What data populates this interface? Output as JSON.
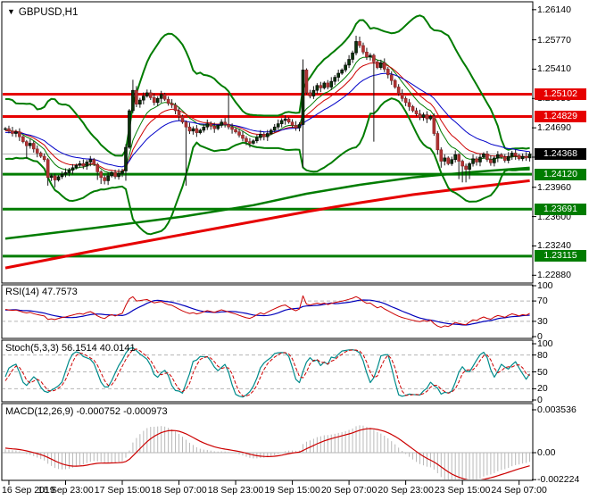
{
  "header": {
    "symbol": "GBPUSD,H1",
    "dropdown_icon": "triangle-down"
  },
  "colors": {
    "bull": "#0a330a",
    "bull_stroke": "#000000",
    "bear": "#b03333",
    "bear_stroke": "#8a2424",
    "wick": "#1a1a1a",
    "band": "#007c00",
    "level_red": "#e60000",
    "level_green": "#007c00",
    "trend_green": "#007c00",
    "trend_red": "#e60000",
    "ema_fast": "#007c00",
    "ema_mid": "#cc0000",
    "ema_slow": "#0000c8",
    "grid_dash": "#b5b5b5",
    "price_line": "#b0b0b0",
    "rsi_main": "#cc0000",
    "rsi_smooth": "#0000bb",
    "stoch_k": "#008b8b",
    "stoch_d": "#cc0000",
    "macd_hist": "#b8b8b8",
    "macd_signal": "#cc0000",
    "border": "#000000"
  },
  "price_axis": {
    "labels": [
      {
        "text": "1.26140",
        "price": 1.2614
      },
      {
        "text": "1.25770",
        "price": 1.2577
      },
      {
        "text": "1.25410",
        "price": 1.2541
      },
      {
        "text": "1.25050",
        "price": 1.2505
      },
      {
        "text": "1.24690",
        "price": 1.2469
      },
      {
        "text": "1.24330",
        "price": 1.2433
      },
      {
        "text": "1.23960",
        "price": 1.2396
      },
      {
        "text": "1.23600",
        "price": 1.236
      },
      {
        "text": "1.23240",
        "price": 1.2324
      },
      {
        "text": "1.22880",
        "price": 1.2288
      }
    ],
    "badges": [
      {
        "text": "1.25102",
        "price": 1.25102,
        "bg": "#e60000"
      },
      {
        "text": "1.24829",
        "price": 1.24829,
        "bg": "#e60000"
      },
      {
        "text": "1.24368",
        "price": 1.24368,
        "bg": "#000000"
      },
      {
        "text": "1.24120",
        "price": 1.2412,
        "bg": "#007c00"
      },
      {
        "text": "1.23691",
        "price": 1.23691,
        "bg": "#007c00"
      },
      {
        "text": "1.23115",
        "price": 1.23115,
        "bg": "#007c00"
      }
    ]
  },
  "time_axis": {
    "labels": [
      {
        "text": "16 Sep 2019",
        "bar": 1,
        "align": "left"
      },
      {
        "text": "16 Sep 23:00",
        "bar": 17,
        "align": "center"
      },
      {
        "text": "17 Sep 15:00",
        "bar": 33,
        "align": "center"
      },
      {
        "text": "18 Sep 07:00",
        "bar": 49,
        "align": "center"
      },
      {
        "text": "18 Sep 23:00",
        "bar": 65,
        "align": "center"
      },
      {
        "text": "19 Sep 15:00",
        "bar": 81,
        "align": "center"
      },
      {
        "text": "20 Sep 07:00",
        "bar": 97,
        "align": "center"
      },
      {
        "text": "20 Sep 23:00",
        "bar": 113,
        "align": "center"
      },
      {
        "text": "23 Sep 15:00",
        "bar": 129,
        "align": "center"
      },
      {
        "text": "24 Sep 07:00",
        "bar": 145,
        "align": "center"
      }
    ]
  },
  "panels": {
    "rsi": {
      "label": "RSI(14) 47.7573",
      "current": 47.7573,
      "period": 14,
      "dashed_levels": [
        70,
        30
      ],
      "axis": [
        {
          "text": "100",
          "v": 100
        },
        {
          "text": "70",
          "v": 70
        },
        {
          "text": "30",
          "v": 30
        },
        {
          "text": "0",
          "v": 0
        }
      ]
    },
    "stoch": {
      "label": "Stoch(5,3,3) 56.1514 40.0141",
      "current_k": 56.1514,
      "current_d": 40.0141,
      "dashed_levels": [
        80,
        50,
        20
      ],
      "axis": [
        {
          "text": "100",
          "v": 100
        },
        {
          "text": "80",
          "v": 80
        },
        {
          "text": "50",
          "v": 50
        },
        {
          "text": "20",
          "v": 20
        },
        {
          "text": "0",
          "v": 0
        }
      ]
    },
    "macd": {
      "label": "MACD(12,26,9) -0.000752 -0.000973",
      "current_macd": -0.000752,
      "current_signal": -0.000973,
      "axis": [
        {
          "text": "0.003536",
          "v": 0.003536
        },
        {
          "text": "0.00",
          "v": 0
        },
        {
          "text": "-0.002224",
          "v": -0.002224
        }
      ]
    }
  },
  "chart_data": {
    "type": "candlestick",
    "symbol": "GBPUSD",
    "timeframe": "H1",
    "title": "GBPUSD,H1",
    "ylim": [
      1.2281,
      1.26215
    ],
    "base_price": 1.2,
    "pip": 0.0001,
    "current_price": 1.24368,
    "pre_closes_pips": [
      448,
      460,
      478,
      490,
      468,
      452,
      444,
      466,
      484,
      492,
      470,
      455,
      446,
      465,
      482,
      488,
      465,
      450,
      458,
      468
    ],
    "closes_pips": [
      468,
      465,
      462,
      464,
      458,
      452,
      447,
      450,
      443,
      438,
      434,
      430,
      408,
      410,
      405,
      409,
      412,
      414,
      417,
      420,
      423,
      425,
      422,
      427,
      430,
      424,
      415,
      408,
      404,
      410,
      414,
      409,
      413,
      416,
      445,
      490,
      515,
      498,
      503,
      508,
      512,
      506,
      500,
      505,
      510,
      504,
      499,
      497,
      490,
      483,
      476,
      470,
      465,
      468,
      463,
      466,
      470,
      474,
      471,
      468,
      472,
      476,
      473,
      470,
      467,
      464,
      460,
      456,
      452,
      450,
      453,
      457,
      461,
      458,
      462,
      466,
      470,
      474,
      478,
      480,
      476,
      472,
      469,
      473,
      540,
      512,
      508,
      515,
      521,
      518,
      524,
      519,
      526,
      531,
      536,
      540,
      546,
      553,
      561,
      575,
      570,
      562,
      556,
      558,
      550,
      543,
      549,
      541,
      534,
      527,
      519,
      511,
      505,
      500,
      495,
      490,
      486,
      482,
      485,
      480,
      483,
      462,
      442,
      428,
      432,
      425,
      430,
      436,
      428,
      422,
      418,
      425,
      431,
      427,
      433,
      437,
      430,
      426,
      432,
      436,
      433,
      429,
      434,
      438,
      435,
      431,
      434,
      432,
      436.8
    ],
    "wick_overrides": {
      "6": [
        2,
        16
      ],
      "12": [
        2,
        10
      ],
      "14": [
        3,
        9
      ],
      "26": [
        2,
        10
      ],
      "27": [
        2,
        8
      ],
      "34": [
        4,
        12
      ],
      "36": [
        13,
        3
      ],
      "40": [
        4,
        2
      ],
      "51": [
        2,
        72
      ],
      "63": [
        38,
        3
      ],
      "84": [
        13,
        53
      ],
      "99": [
        7,
        3
      ],
      "100": [
        6,
        3
      ],
      "104": [
        2,
        98
      ],
      "122": [
        3,
        6
      ],
      "123": [
        3,
        8
      ],
      "128": [
        2,
        22
      ],
      "129": [
        2,
        20
      ],
      "130": [
        3,
        16
      ],
      "131": [
        2,
        12
      ]
    },
    "horizontal_levels": [
      {
        "price": 1.25102,
        "color": "#e60000",
        "kind": "resistance"
      },
      {
        "price": 1.24829,
        "color": "#e60000",
        "kind": "resistance"
      },
      {
        "price": 1.2412,
        "color": "#007c00",
        "kind": "support"
      },
      {
        "price": 1.23691,
        "color": "#007c00",
        "kind": "support"
      },
      {
        "price": 1.23115,
        "color": "#007c00",
        "kind": "support"
      }
    ],
    "trend_lines": {
      "green_slow_ma": [
        [
          0,
          1.2333
        ],
        [
          25,
          1.2346
        ],
        [
          50,
          1.236
        ],
        [
          70,
          1.2374
        ],
        [
          85,
          1.2388
        ],
        [
          100,
          1.2399
        ],
        [
          115,
          1.2408
        ],
        [
          130,
          1.2414
        ],
        [
          148,
          1.242
        ]
      ],
      "red_slow_ma": [
        [
          0,
          1.2297
        ],
        [
          25,
          1.2318
        ],
        [
          50,
          1.2338
        ],
        [
          70,
          1.2354
        ],
        [
          85,
          1.2366
        ],
        [
          100,
          1.2377
        ],
        [
          115,
          1.2387
        ],
        [
          130,
          1.2395
        ],
        [
          148,
          1.2404
        ]
      ]
    },
    "overlays": {
      "bollinger": {
        "period": 20,
        "mult": 2.6
      },
      "ema_fast": 8,
      "ema_mid": 13,
      "ema_slow": 24
    }
  }
}
